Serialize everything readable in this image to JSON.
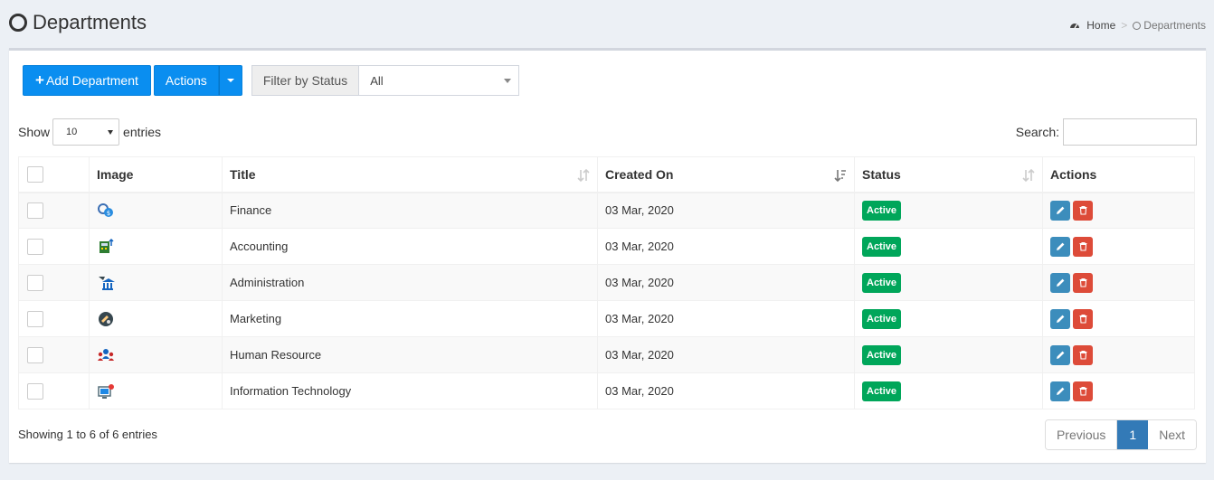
{
  "header": {
    "title": "Departments"
  },
  "breadcrumb": {
    "home": "Home",
    "sep": ">",
    "current": "Departments"
  },
  "toolbar": {
    "add_label": "Add Department",
    "actions_label": "Actions",
    "filter_label": "Filter by Status",
    "filter_value": "All"
  },
  "table_controls": {
    "show": "Show",
    "entries_value": "10",
    "entries": "entries",
    "search_label": "Search:"
  },
  "columns": [
    "Image",
    "Title",
    "Created On",
    "Status",
    "Actions"
  ],
  "rows": [
    {
      "title": "Finance",
      "created": "03 Mar, 2020",
      "status": "Active",
      "icon": "finance-icon"
    },
    {
      "title": "Accounting",
      "created": "03 Mar, 2020",
      "status": "Active",
      "icon": "accounting-icon"
    },
    {
      "title": "Administration",
      "created": "03 Mar, 2020",
      "status": "Active",
      "icon": "administration-icon"
    },
    {
      "title": "Marketing",
      "created": "03 Mar, 2020",
      "status": "Active",
      "icon": "marketing-icon"
    },
    {
      "title": "Human Resource",
      "created": "03 Mar, 2020",
      "status": "Active",
      "icon": "human-resource-icon"
    },
    {
      "title": "Information Technology",
      "created": "03 Mar, 2020",
      "status": "Active",
      "icon": "information-technology-icon"
    }
  ],
  "footer": {
    "info": "Showing 1 to 6 of 6 entries",
    "previous": "Previous",
    "page": "1",
    "next": "Next"
  },
  "colors": {
    "primary": "#0a8ef0",
    "success": "#00a65a",
    "danger": "#dd4b39",
    "edit": "#3c8dbc"
  }
}
